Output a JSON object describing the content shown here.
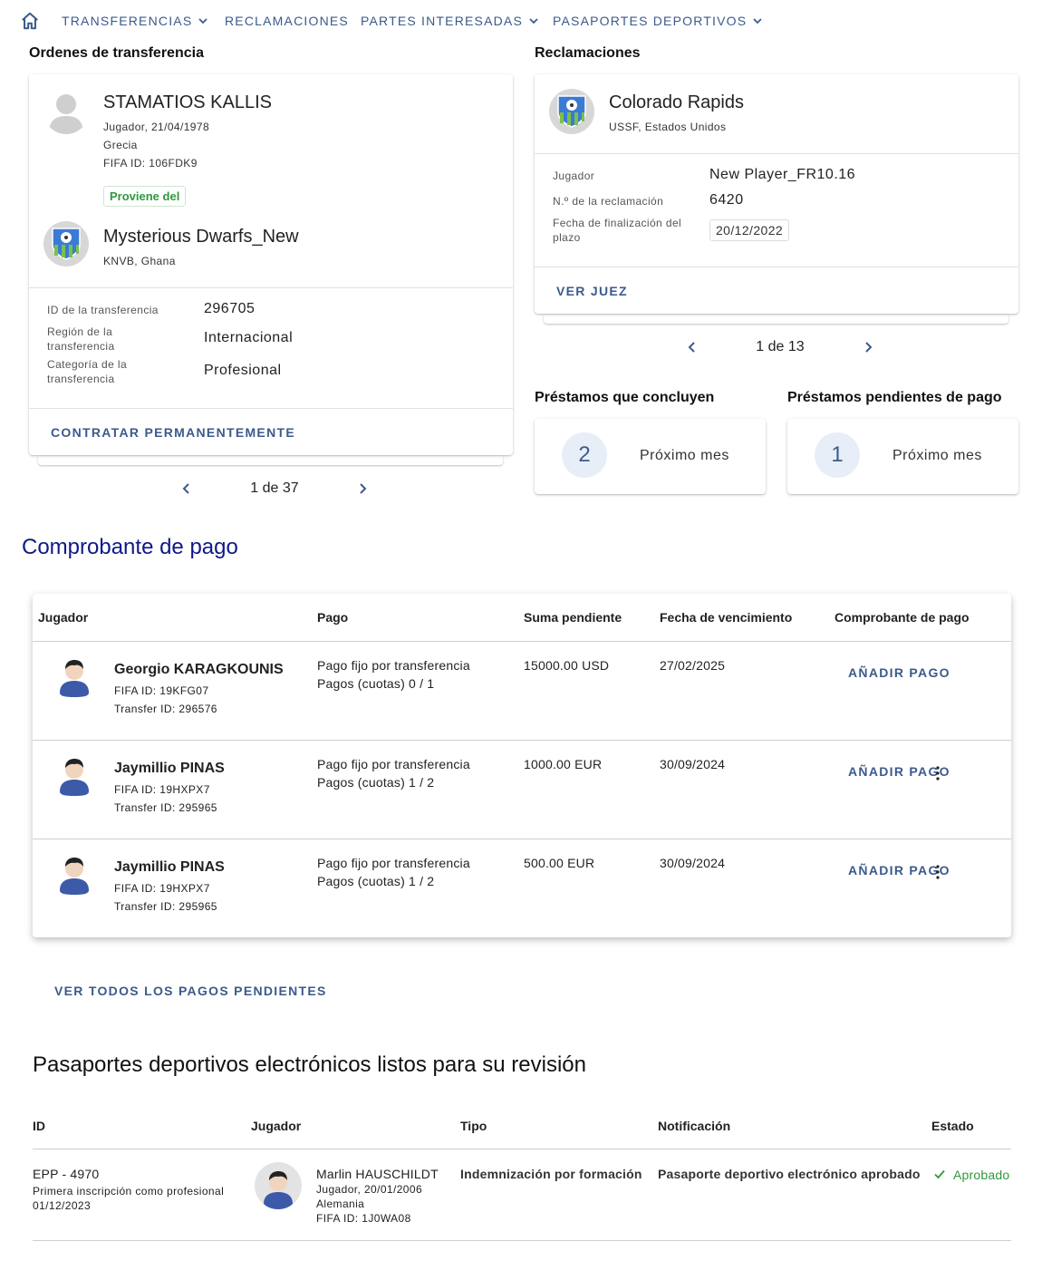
{
  "nav": {
    "items": [
      {
        "label": "TRANSFERENCIAS",
        "dropdown": true
      },
      {
        "label": "RECLAMACIONES",
        "dropdown": false
      },
      {
        "label": "PARTES INTERESADAS",
        "dropdown": true
      },
      {
        "label": "PASAPORTES DEPORTIVOS",
        "dropdown": true
      }
    ]
  },
  "transfers": {
    "title": "Ordenes de transferencia",
    "player": {
      "name": "STAMATIOS KALLIS",
      "role_dob": "Jugador, 21/04/1978",
      "country": "Grecia",
      "fifa_id": "FIFA ID: 106FDK9"
    },
    "from_badge": "Proviene del",
    "club": {
      "name": "Mysterious Dwarfs_New",
      "assoc": "KNVB, Ghana"
    },
    "details": [
      {
        "label": "ID de la transferencia",
        "value": "296705"
      },
      {
        "label": "Región de la transferencia",
        "value": "Internacional"
      },
      {
        "label": "Categoría de la transferencia",
        "value": "Profesional"
      }
    ],
    "action": "CONTRATAR PERMANENTEMENTE",
    "pager": "1 de 37"
  },
  "claims": {
    "title": "Reclamaciones",
    "club": {
      "name": "Colorado Rapids",
      "assoc": "USSF, Estados Unidos"
    },
    "details": [
      {
        "label": "Jugador",
        "value": "New Player_FR10.16"
      },
      {
        "label": "N.º de la reclamación",
        "value": "6420"
      },
      {
        "label": "Fecha de finalización del plazo",
        "value": "20/12/2022"
      }
    ],
    "action": "VER JUEZ",
    "pager": "1 de 13"
  },
  "loans_ending": {
    "title": "Préstamos que concluyen",
    "count": "2",
    "text": "Próximo mes"
  },
  "loans_pending": {
    "title": "Préstamos pendientes de pago",
    "count": "1",
    "text": "Próximo mes"
  },
  "payment": {
    "title": "Comprobante de pago",
    "headers": [
      "Jugador",
      "Pago",
      "Suma pendiente",
      "Fecha de vencimiento",
      "Comprobante de pago"
    ],
    "rows": [
      {
        "name": "Georgio KARAGKOUNIS",
        "fifa": "FIFA ID: 19KFG07",
        "transfer": "Transfer ID: 296576",
        "pay1": "Pago fijo por transferencia",
        "pay2": "Pagos (cuotas) 0 / 1",
        "amount": "15000.00 USD",
        "due": "27/02/2025",
        "action": "AÑADIR PAGO"
      },
      {
        "name": "Jaymillio PINAS",
        "fifa": "FIFA ID: 19HXPX7",
        "transfer": "Transfer ID: 295965",
        "pay1": "Pago fijo por transferencia",
        "pay2": "Pagos (cuotas) 1 / 2",
        "amount": "1000.00 EUR",
        "due": "30/09/2024",
        "action": "AÑADIR PAGO"
      },
      {
        "name": "Jaymillio PINAS",
        "fifa": "FIFA ID: 19HXPX7",
        "transfer": "Transfer ID: 295965",
        "pay1": "Pago fijo por transferencia",
        "pay2": "Pagos (cuotas) 1 / 2",
        "amount": "500.00 EUR",
        "due": "30/09/2024",
        "action": "AÑADIR PAGO"
      }
    ],
    "view_all": "VER TODOS LOS PAGOS PENDIENTES"
  },
  "passports": {
    "title": "Pasaportes deportivos electrónicos listos para su revisión",
    "headers": [
      "ID",
      "Jugador",
      "Tipo",
      "Notificación",
      "Estado"
    ],
    "row": {
      "id": "EPP - 4970",
      "id_sub1": "Primera inscripción como profesional",
      "id_sub2": "01/12/2023",
      "player_name": "Marlin HAUSCHILDT",
      "player_role": "Jugador, 20/01/2006",
      "player_country": "Alemania",
      "player_fifa": "FIFA ID: 1J0WA08",
      "type": "Indemnización por formación",
      "notification": "Pasaporte deportivo electrónico aprobado",
      "status": "Aprobado"
    }
  },
  "colors": {
    "accent": "#3b5a8c",
    "green": "#2e9a3c",
    "heading_blue": "#10188a"
  }
}
